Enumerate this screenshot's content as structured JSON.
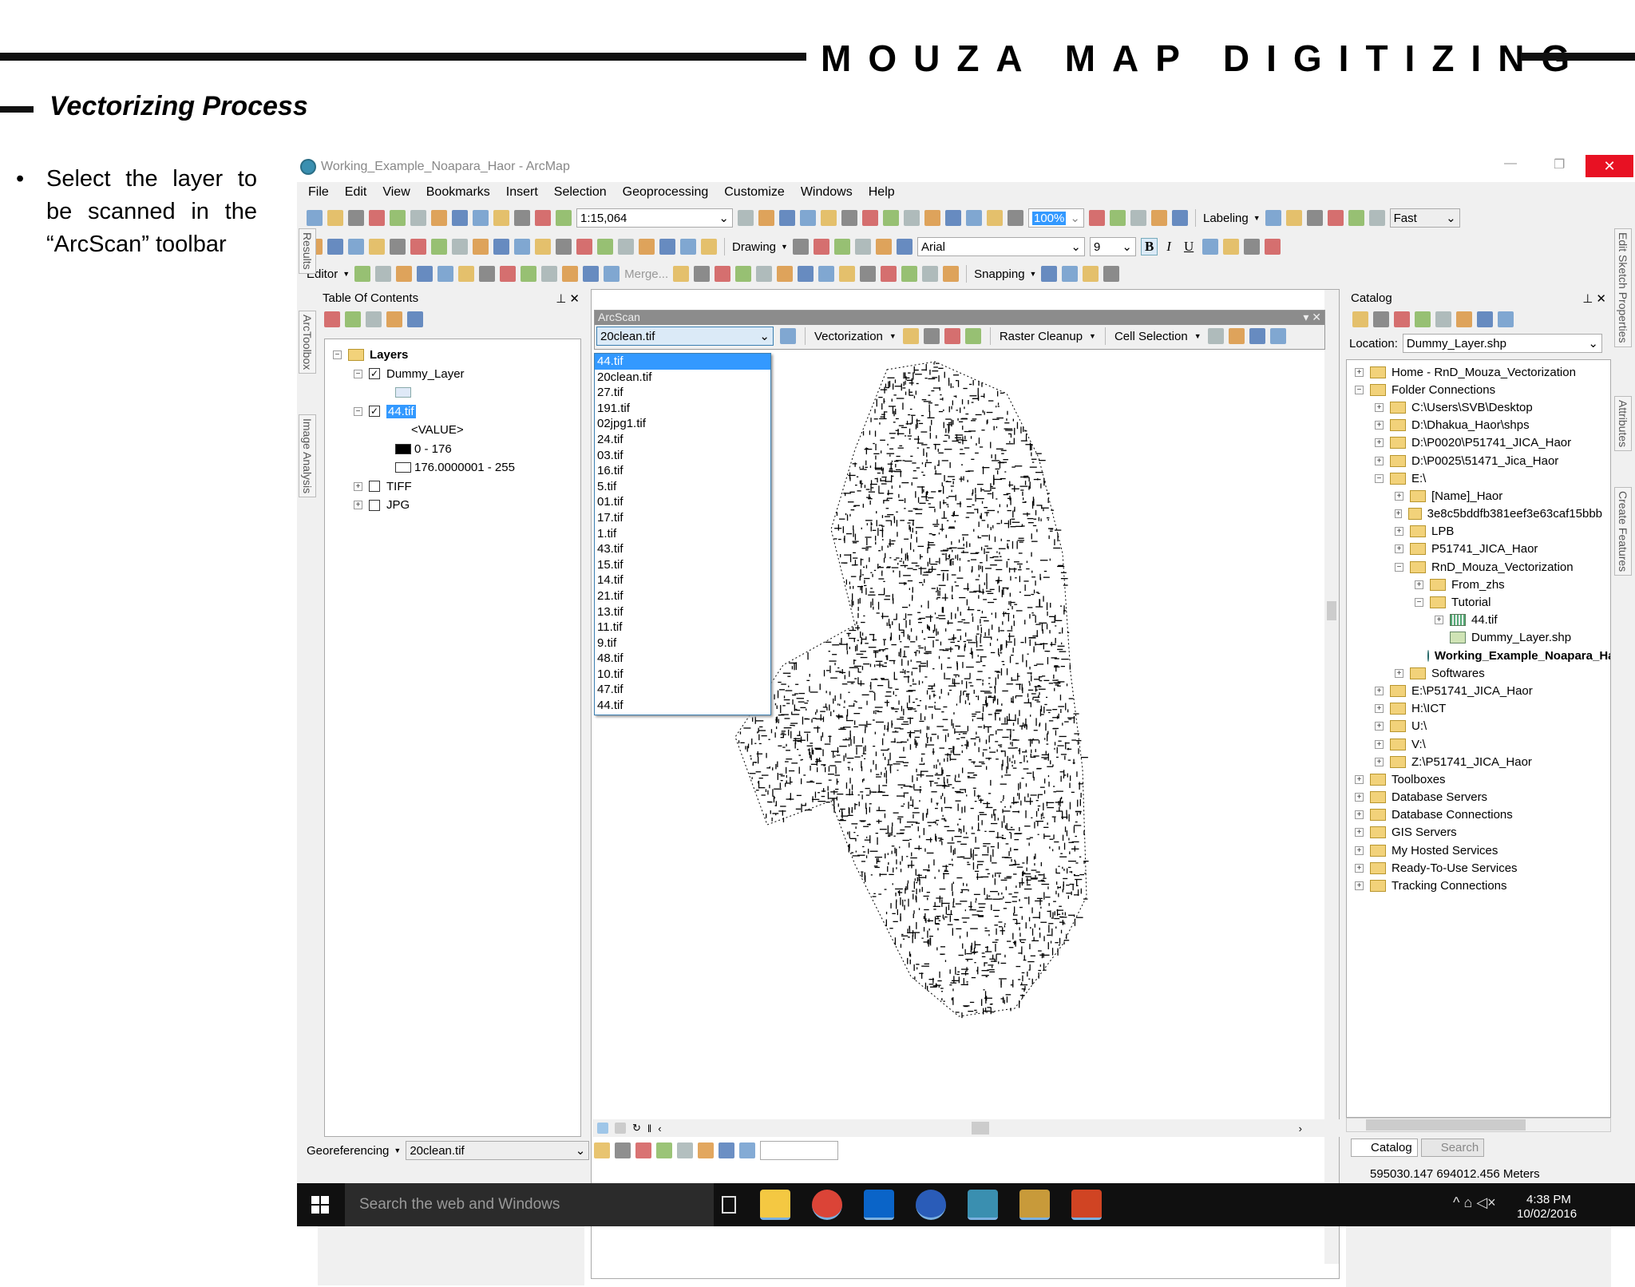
{
  "slide": {
    "title": "MOUZA MAP DIGITIZING",
    "subtitle": "Vectorizing Process",
    "bullet": "Select the layer to be scanned in the “ArcScan” toolbar",
    "bullet_symbol": "•"
  },
  "window": {
    "title": "Working_Example_Noapara_Haor - ArcMap",
    "minimize": "—",
    "restore": "❐",
    "close": "✕"
  },
  "menu": [
    "File",
    "Edit",
    "View",
    "Bookmarks",
    "Insert",
    "Selection",
    "Geoprocessing",
    "Customize",
    "Windows",
    "Help"
  ],
  "toolbar": {
    "scale": "1:15,064",
    "zoom": "100%",
    "labeling": "Labeling",
    "label_quality": "Fast",
    "drawing": "Drawing",
    "font": "Arial",
    "font_size": "9",
    "bold": "B",
    "italic": "I",
    "underline": "U",
    "editor": "Editor",
    "merge": "Merge...",
    "snapping": "Snapping"
  },
  "toc": {
    "title": "Table Of Contents",
    "layers_label": "Layers",
    "items": [
      {
        "name": "Dummy_Layer",
        "checked": true
      },
      {
        "name": "44.tif",
        "checked": true,
        "selected": true
      },
      {
        "name": "TIFF",
        "checked": false
      },
      {
        "name": "JPG",
        "checked": false
      }
    ],
    "value_label": "<VALUE>",
    "legend": [
      {
        "label": "0 - 176",
        "color": "#000000"
      },
      {
        "label": "176.0000001 - 255",
        "color": "#ffffff"
      }
    ]
  },
  "left_tabs": [
    "Results",
    "ArcToolbox",
    "Image Analysis"
  ],
  "arcscan": {
    "title": "ArcScan",
    "selected_layer": "20clean.tif",
    "vectorization": "Vectorization",
    "raster_cleanup": "Raster Cleanup",
    "cell_selection": "Cell Selection",
    "options": [
      "44.tif",
      "20clean.tif",
      "27.tif",
      "191.tif",
      "02jpg1.tif",
      "24.tif",
      "03.tif",
      "16.tif",
      "5.tif",
      "01.tif",
      "17.tif",
      "1.tif",
      "43.tif",
      "15.tif",
      "14.tif",
      "21.tif",
      "13.tif",
      "11.tif",
      "9.tif",
      "48.tif",
      "10.tif",
      "47.tif",
      "44.tif"
    ],
    "highlighted": "44.tif"
  },
  "catalog": {
    "title": "Catalog",
    "location_label": "Location:",
    "location": "Dummy_Layer.shp",
    "tree": [
      {
        "label": "Home - RnD_Mouza_Vectorization",
        "level": 0,
        "pm": "+"
      },
      {
        "label": "Folder Connections",
        "level": 0,
        "pm": "-"
      },
      {
        "label": "C:\\Users\\SVB\\Desktop",
        "level": 1,
        "pm": "+"
      },
      {
        "label": "D:\\Dhakua_Haor\\shps",
        "level": 1,
        "pm": "+"
      },
      {
        "label": "D:\\P0020\\P51741_JICA_Haor",
        "level": 1,
        "pm": "+"
      },
      {
        "label": "D:\\P0025\\51471_Jica_Haor",
        "level": 1,
        "pm": "+"
      },
      {
        "label": "E:\\",
        "level": 1,
        "pm": "-"
      },
      {
        "label": "[Name]_Haor",
        "level": 2,
        "pm": "+"
      },
      {
        "label": "3e8c5bddfb381eef3e63caf15bbb",
        "level": 2,
        "pm": "+"
      },
      {
        "label": "LPB",
        "level": 2,
        "pm": "+"
      },
      {
        "label": "P51741_JICA_Haor",
        "level": 2,
        "pm": "+"
      },
      {
        "label": "RnD_Mouza_Vectorization",
        "level": 2,
        "pm": "-"
      },
      {
        "label": "From_zhs",
        "level": 3,
        "pm": "+"
      },
      {
        "label": "Tutorial",
        "level": 3,
        "pm": "-"
      },
      {
        "label": "44.tif",
        "level": 4,
        "pm": "+",
        "kind": "raster"
      },
      {
        "label": "Dummy_Layer.shp",
        "level": 4,
        "pm": "",
        "kind": "shape"
      },
      {
        "label": "Working_Example_Noapara_Haor",
        "level": 3,
        "pm": "",
        "kind": "mxd",
        "bold": true
      },
      {
        "label": "Softwares",
        "level": 2,
        "pm": "+"
      },
      {
        "label": "E:\\P51741_JICA_Haor",
        "level": 1,
        "pm": "+"
      },
      {
        "label": "H:\\ICT",
        "level": 1,
        "pm": "+"
      },
      {
        "label": "U:\\",
        "level": 1,
        "pm": "+"
      },
      {
        "label": "V:\\",
        "level": 1,
        "pm": "+"
      },
      {
        "label": "Z:\\P51741_JICA_Haor",
        "level": 1,
        "pm": "+"
      },
      {
        "label": "Toolboxes",
        "level": 0,
        "pm": "+"
      },
      {
        "label": "Database Servers",
        "level": 0,
        "pm": "+"
      },
      {
        "label": "Database Connections",
        "level": 0,
        "pm": "+"
      },
      {
        "label": "GIS Servers",
        "level": 0,
        "pm": "+"
      },
      {
        "label": "My Hosted Services",
        "level": 0,
        "pm": "+"
      },
      {
        "label": "Ready-To-Use Services",
        "level": 0,
        "pm": "+"
      },
      {
        "label": "Tracking Connections",
        "level": 0,
        "pm": "+"
      }
    ],
    "tabs": [
      "Catalog",
      "Search"
    ]
  },
  "right_tabs": [
    "Edit Sketch Properties",
    "Attributes",
    "Create Features"
  ],
  "georef": {
    "label": "Georeferencing",
    "layer": "20clean.tif"
  },
  "status": {
    "coords": "595030.147  694012.456 Meters"
  },
  "taskbar": {
    "search": "Search the web and Windows",
    "time": "4:38 PM",
    "date": "10/02/2016",
    "apps": [
      {
        "name": "file-explorer",
        "color": "#f4c842"
      },
      {
        "name": "chrome",
        "color": "#db4437"
      },
      {
        "name": "outlook",
        "color": "#0a64c8"
      },
      {
        "name": "google-earth",
        "color": "#2a5cb8"
      },
      {
        "name": "arcmap",
        "color": "#3a8fb0"
      },
      {
        "name": "arccatalog",
        "color": "#c89a3a"
      },
      {
        "name": "powerpoint",
        "color": "#d04423"
      }
    ]
  },
  "colors": {
    "accent": "#3399ff",
    "close": "#e81123",
    "taskbar": "#101010"
  }
}
